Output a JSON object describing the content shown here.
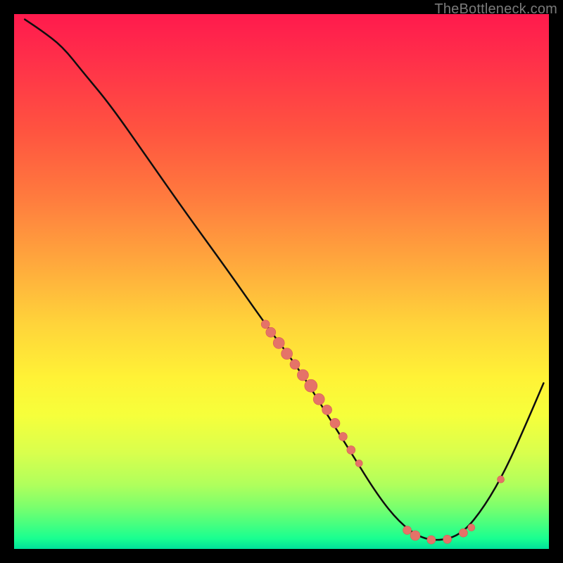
{
  "watermark": "TheBottleneck.com",
  "colors": {
    "point_fill": "#e57368",
    "point_stroke": "#d85a55",
    "curve_stroke": "#0e0e0e"
  },
  "chart_data": {
    "type": "line",
    "title": "",
    "xlabel": "",
    "ylabel": "",
    "xlim": [
      0,
      100
    ],
    "ylim": [
      0,
      100
    ],
    "curve": [
      {
        "x": 2,
        "y": 99
      },
      {
        "x": 5,
        "y": 97
      },
      {
        "x": 9,
        "y": 94
      },
      {
        "x": 13,
        "y": 89
      },
      {
        "x": 18,
        "y": 83
      },
      {
        "x": 25,
        "y": 73
      },
      {
        "x": 32,
        "y": 63
      },
      {
        "x": 40,
        "y": 52
      },
      {
        "x": 47,
        "y": 42
      },
      {
        "x": 53,
        "y": 34
      },
      {
        "x": 58,
        "y": 26
      },
      {
        "x": 63,
        "y": 18
      },
      {
        "x": 68,
        "y": 10
      },
      {
        "x": 72,
        "y": 5
      },
      {
        "x": 76,
        "y": 2
      },
      {
        "x": 80,
        "y": 1.5
      },
      {
        "x": 84,
        "y": 3
      },
      {
        "x": 88,
        "y": 8
      },
      {
        "x": 92,
        "y": 15
      },
      {
        "x": 96,
        "y": 24
      },
      {
        "x": 99,
        "y": 31
      }
    ],
    "points": [
      {
        "x": 47,
        "y": 42,
        "r": 6
      },
      {
        "x": 48,
        "y": 40.5,
        "r": 7
      },
      {
        "x": 49.5,
        "y": 38.5,
        "r": 8
      },
      {
        "x": 51,
        "y": 36.5,
        "r": 8
      },
      {
        "x": 52.5,
        "y": 34.5,
        "r": 7
      },
      {
        "x": 54,
        "y": 32.5,
        "r": 8
      },
      {
        "x": 55.5,
        "y": 30.5,
        "r": 9
      },
      {
        "x": 57,
        "y": 28,
        "r": 8
      },
      {
        "x": 58.5,
        "y": 26,
        "r": 7
      },
      {
        "x": 60,
        "y": 23.5,
        "r": 7
      },
      {
        "x": 61.5,
        "y": 21,
        "r": 6
      },
      {
        "x": 63,
        "y": 18.5,
        "r": 6
      },
      {
        "x": 64.5,
        "y": 16,
        "r": 5
      },
      {
        "x": 73.5,
        "y": 3.5,
        "r": 6
      },
      {
        "x": 75,
        "y": 2.5,
        "r": 7
      },
      {
        "x": 78,
        "y": 1.7,
        "r": 6
      },
      {
        "x": 81,
        "y": 1.8,
        "r": 6
      },
      {
        "x": 84,
        "y": 3,
        "r": 6
      },
      {
        "x": 85.5,
        "y": 4,
        "r": 5
      },
      {
        "x": 91,
        "y": 13,
        "r": 5
      }
    ]
  }
}
